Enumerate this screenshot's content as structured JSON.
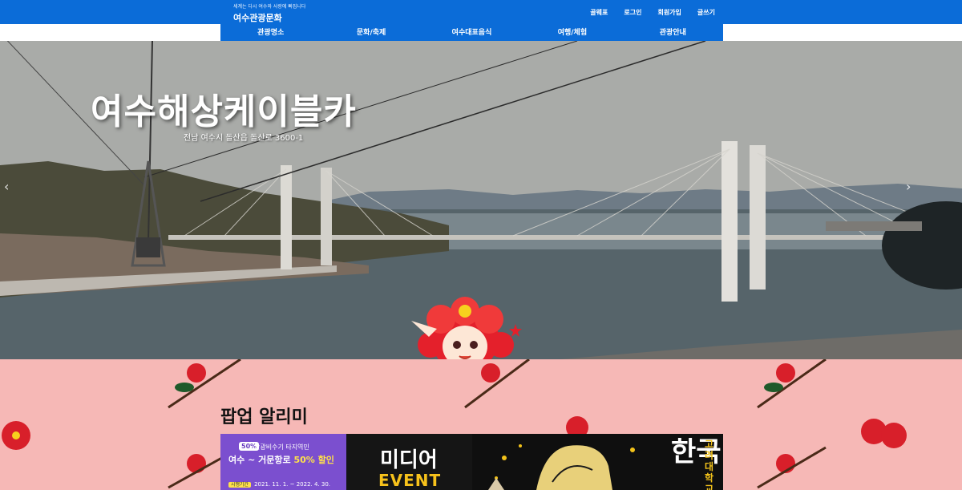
{
  "header": {
    "logo_slogan": "세계는 다시 여수와 사랑에 빠집니다",
    "logo_title": "여수관광문화",
    "util_links": [
      "골웨표",
      "로그인",
      "회원가입",
      "글쓰기"
    ],
    "brand_color": "#0b6cd8"
  },
  "nav": {
    "items": [
      "관광명소",
      "문화/축제",
      "여수대표음식",
      "여행/체험",
      "관광안내"
    ]
  },
  "hero": {
    "title": "여수해상케이블카",
    "address": "전남 여수시 돌산읍 돌산로 3600-1",
    "prev_icon": "chevron-left-icon",
    "next_icon": "chevron-right-icon"
  },
  "popup": {
    "title": "팝업 알리미",
    "background_color": "#f6b8b6",
    "banner1": {
      "badge": "50%",
      "line1": "관광비수기 타지역민",
      "line2_a": "여수 ~ 거문항로 ",
      "line2_b": "50% 할인",
      "tag": "시행기간",
      "period": "2021. 11. 1. ~ 2022. 4. 30."
    },
    "banner2": {
      "line1": "미디어",
      "line2": "EVENT"
    },
    "banner3": {
      "big": "한국",
      "side": "고려대학교"
    }
  }
}
